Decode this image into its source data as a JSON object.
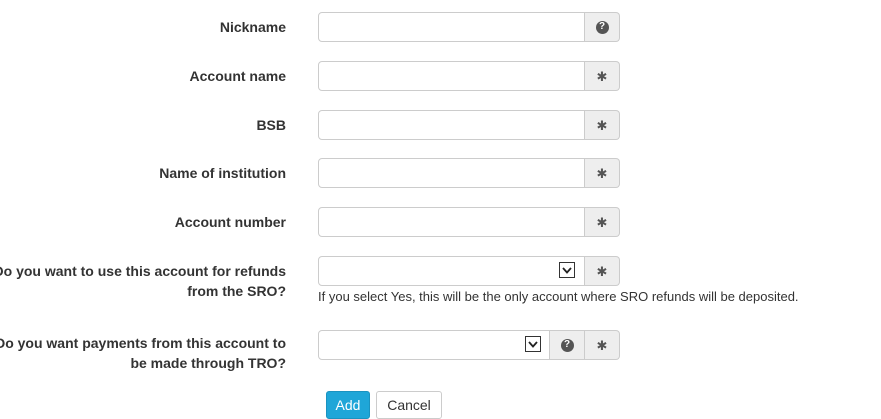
{
  "form": {
    "fields": [
      {
        "label": "Nickname",
        "addon_icons": [
          "question-icon"
        ]
      },
      {
        "label": "Account name",
        "addon_icons": [
          "required-icon"
        ]
      },
      {
        "label": "BSB",
        "addon_icons": [
          "required-icon"
        ]
      },
      {
        "label": "Name of institution",
        "addon_icons": [
          "required-icon"
        ]
      },
      {
        "label": "Account number",
        "addon_icons": [
          "required-icon"
        ]
      },
      {
        "label": "Do you want to use this account for refunds from the SRO?",
        "addon_icons": [
          "required-icon"
        ],
        "type": "select",
        "value": ""
      },
      {
        "label": "Do you want payments from this account to be made through TRO?",
        "addon_icons": [
          "question-icon",
          "required-icon"
        ],
        "type": "select",
        "value": ""
      }
    ],
    "refund_help_text": "If you select Yes, this will be the only account where SRO refunds will be deposited.",
    "icons": {
      "required": "✱",
      "question": "?"
    },
    "add_label": "Add",
    "cancel_label": "Cancel"
  },
  "colors": {
    "primary": "#1fa6d8",
    "addon_bg": "#eeeeee",
    "border": "#cccccc",
    "text": "#333333"
  }
}
